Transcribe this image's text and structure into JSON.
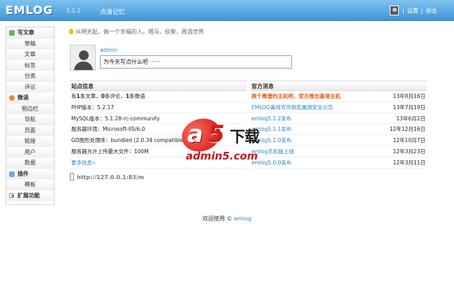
{
  "header": {
    "logo": "EMLOG",
    "version": "5.1.2",
    "blog_name": "点滴记忆",
    "links": [
      "设置",
      "退出"
    ]
  },
  "sidebar": {
    "items": [
      {
        "label": "写文章",
        "icon": "write-icon"
      },
      {
        "label": "草稿"
      },
      {
        "label": "文章"
      },
      {
        "label": "标签"
      },
      {
        "label": "分类"
      },
      {
        "label": "评论"
      },
      {
        "label": "微语",
        "icon": "twitter-icon"
      },
      {
        "label": "侧边栏"
      },
      {
        "label": "导航"
      },
      {
        "label": "页面"
      },
      {
        "label": "链接"
      },
      {
        "label": "用户"
      },
      {
        "label": "数据"
      },
      {
        "label": "插件",
        "icon": "plugin-icon"
      },
      {
        "label": "模板"
      },
      {
        "label": "扩展功能",
        "icon": "expand-icon"
      }
    ]
  },
  "main": {
    "tip": "从明天起，做一个幸福的人。喂马，砍柴，周游世界",
    "username": "admin",
    "twitter_value": "为今天写点什么吧 ······",
    "site_info": {
      "title": "站点信息",
      "summary": {
        "posts": "1",
        "posts_label": "条文章，",
        "comments": "0",
        "comments_label": "条评论，",
        "twitters": "1",
        "twitters_label": "条微语",
        "prefix": "有"
      },
      "rows": [
        "PHP版本：5.2.17",
        "MySQL版本：5.1.28-rc-community",
        "服务器环境：Microsoft-IIS/6.0",
        "GD图形处理库：bundled (2.0.34 compatible",
        "服务器允许上传最大文件：100M"
      ],
      "more": "更多信息»"
    },
    "news": {
      "title": "官方消息",
      "items": [
        {
          "title": "换个靠谱的主机吧，官方推出香港主机",
          "date": "13年8月16日",
          "hot": true
        },
        {
          "title": "EMLOG离线写作高危漏洞安全公告",
          "date": "13年7月19日",
          "hot": false
        },
        {
          "title": "emlog5.1.2发布",
          "date": "13年6月2日",
          "hot": false
        },
        {
          "title": "emlog5.1.1发布",
          "date": "12年12月16日",
          "hot": false
        },
        {
          "title": "emlog5.1.0发布",
          "date": "12年10月7日",
          "hot": false
        },
        {
          "title": "emlog手机版上线",
          "date": "12年3月23日",
          "hot": false
        },
        {
          "title": "emlog5.0.0发布",
          "date": "12年3月11日",
          "hot": false
        }
      ]
    },
    "mobile_url": "http://127.0.0.1:83/m"
  },
  "footer": {
    "text": "欢迎使用 © ",
    "link": "emlog"
  },
  "watermark": {
    "logo_a": "a",
    "logo_5": "5",
    "logo_text": "下载",
    "domain": "admin5.com"
  }
}
